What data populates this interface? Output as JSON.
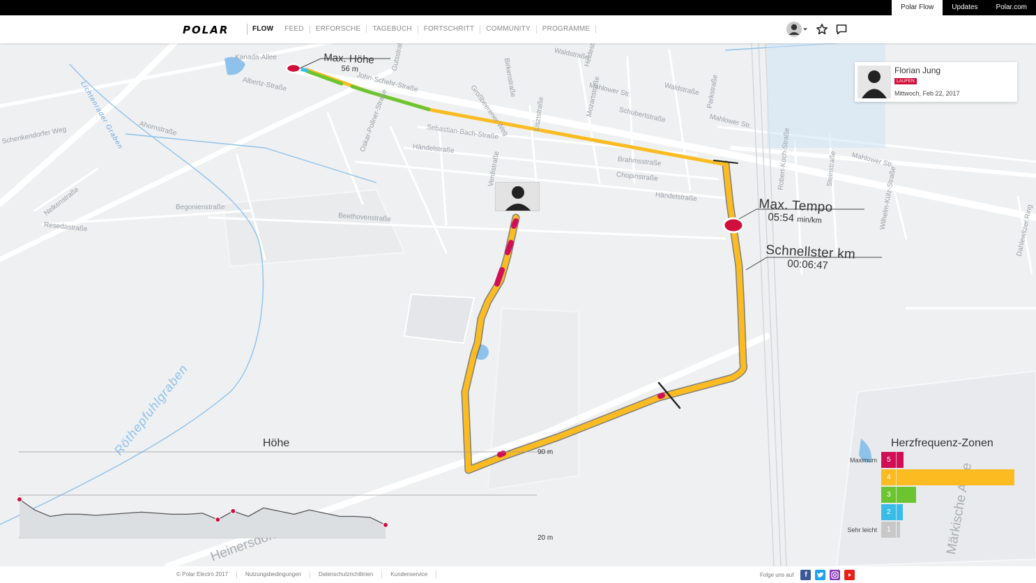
{
  "topbar": {
    "links": [
      "Polar Flow",
      "Updates",
      "Polar.com"
    ]
  },
  "nav": {
    "logo": "POLAR",
    "items": [
      "FLOW",
      "FEED",
      "ERFORSCHE",
      "TAGEBUCH",
      "FORTSCHRITT",
      "COMMUNITY",
      "PROGRAMME"
    ]
  },
  "user": {
    "name": "Florian Jung",
    "sport": "LAUFEN",
    "date": "Mittwoch, Feb 22, 2017"
  },
  "route": {
    "max_height_title": "Max. Höhe",
    "max_height_value": "56 m",
    "max_pace_title": "Max. Tempo",
    "max_pace_value": "05:54",
    "max_pace_unit": "min/km",
    "fastest_km_title": "Schnellster km",
    "fastest_km_value": "00:06:47"
  },
  "map_labels": {
    "streets": [
      "Kanada-Allee",
      "Max. Höhe",
      "Gutsstraße",
      "Birkenstraße",
      "Waldstraße",
      "Heidestraße",
      "Mahlower Str.",
      "Waldstraße",
      "Schubertstraße",
      "Mahlower Str.",
      "Mahlower Str.",
      "Sebastian-Bach-Straße",
      "Händelstraße",
      "Brahmsstraße",
      "Chopinstraße",
      "Händelstraße",
      "Beethovenstraße",
      "Begonienstraße",
      "Resedastraße",
      "Nelkenstraße",
      "Schenkendorfer Weg",
      "Ahornstraße",
      "Verdistraße",
      "Robert-Koch-Straße",
      "Wilhelm-Külz-Straße",
      "Steinstraße",
      "Parkstraße",
      "Mozartstraße",
      "Lisztstraße",
      "Großbeerener Weg",
      "Oskar-Pollner-Straße",
      "John-Schehr-Straße",
      "Albertz-Straße",
      "Heinersdorfer Weg",
      "Märkische Allee",
      "Dahlewitzer Ring"
    ],
    "waters": [
      "Röthepfuhlgraben",
      "Lichtenrader Graben"
    ]
  },
  "elevation": {
    "title": "Höhe",
    "max_label": "90 m",
    "min_label": "20 m",
    "profile": [
      56,
      46,
      40,
      42,
      42,
      41,
      42,
      43,
      44,
      43,
      42,
      42,
      43,
      37,
      45,
      40,
      48,
      45,
      42,
      46,
      43,
      40,
      40,
      39,
      32
    ]
  },
  "hr_zones": {
    "title": "Herzfrequenz-Zonen",
    "top_label": "Maximum",
    "bottom_label": "Sehr leicht",
    "zones": [
      {
        "zone": "5",
        "fraction": 0.17,
        "color": "#d10f57"
      },
      {
        "zone": "4",
        "fraction": 1.0,
        "color": "#fbbb21"
      },
      {
        "zone": "3",
        "fraction": 0.26,
        "color": "#6cc530"
      },
      {
        "zone": "2",
        "fraction": 0.16,
        "color": "#39bde8"
      },
      {
        "zone": "1",
        "fraction": 0.14,
        "color": "#c8c8c8"
      }
    ]
  },
  "footer": {
    "links": [
      "© Polar Electro 2017",
      "Nutzungsbedingungen",
      "Datenschutzrichtlinien",
      "Kundenservice"
    ],
    "follow": "Folge uns auf",
    "social": [
      "facebook-icon",
      "twitter-icon",
      "instagram-icon",
      "youtube-icon"
    ]
  }
}
